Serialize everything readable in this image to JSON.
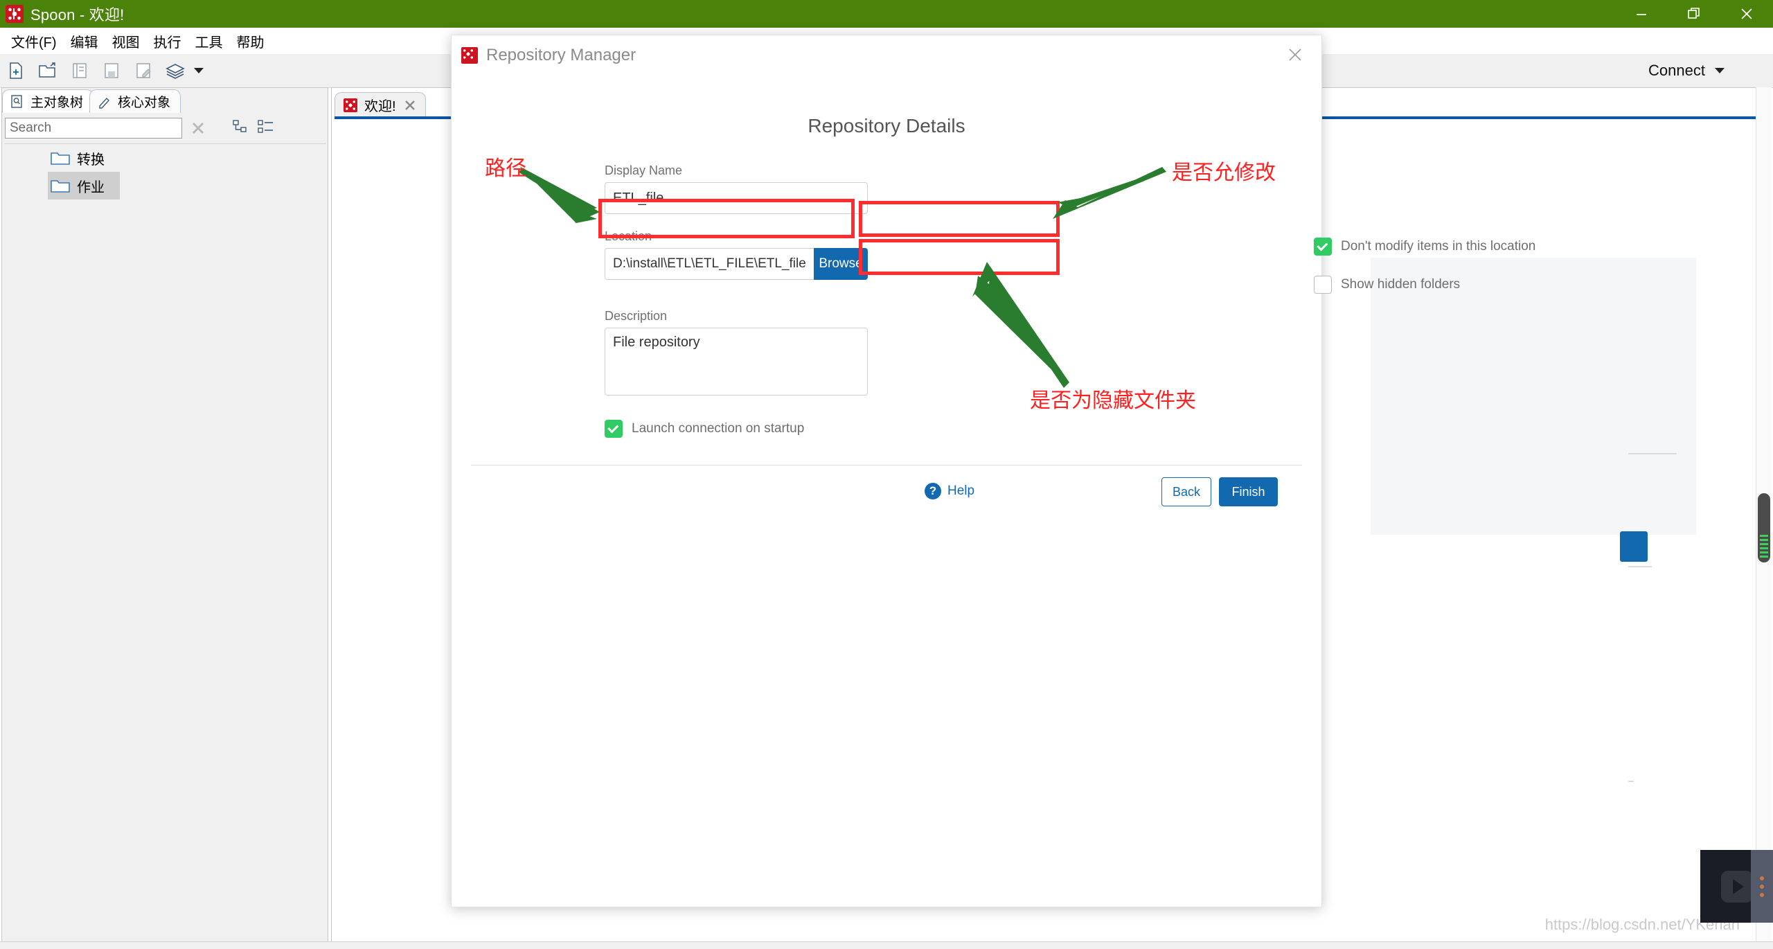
{
  "window": {
    "title": "Spoon - 欢迎!",
    "icon": "spoon-logo-icon",
    "minimize": "minimize-icon",
    "maximize": "maximize-icon",
    "close": "close-icon"
  },
  "menubar": {
    "items": [
      {
        "label": "文件(F)"
      },
      {
        "label": "编辑"
      },
      {
        "label": "视图"
      },
      {
        "label": "执行"
      },
      {
        "label": "工具"
      },
      {
        "label": "帮助"
      }
    ]
  },
  "toolbar": {
    "buttons": [
      {
        "name": "new-file-icon"
      },
      {
        "name": "open-file-icon"
      },
      {
        "name": "explorer-icon"
      },
      {
        "name": "save-icon"
      },
      {
        "name": "save-as-icon"
      },
      {
        "name": "layers-icon"
      }
    ],
    "connect_label": "Connect"
  },
  "sidebar": {
    "tabs": [
      {
        "label": "主对象树",
        "icon": "document-search-icon",
        "active": true
      },
      {
        "label": "核心对象",
        "icon": "pencil-icon",
        "active": false
      }
    ],
    "search": {
      "value": "Search",
      "placeholder": "Search"
    },
    "clear_icon": "clear-x-icon",
    "tree_view_icons": [
      "tree-hierarchy-icon",
      "tree-list-icon"
    ],
    "tree_nodes": [
      {
        "label": "转换",
        "selected": false
      },
      {
        "label": "作业",
        "selected": true
      }
    ]
  },
  "main": {
    "tabs": [
      {
        "label": "欢迎!",
        "close_icon": "tab-close-icon"
      }
    ]
  },
  "dialog": {
    "title": "Repository Manager",
    "close_icon": "dialog-close-icon",
    "heading": "Repository Details",
    "fields": {
      "display_name": {
        "label": "Display Name",
        "value": "ETL_file",
        "placeholder": ""
      },
      "location": {
        "label": "Location",
        "value": "D:\\install\\ETL\\ETL_FILE\\ETL_file",
        "placeholder": ""
      },
      "browse_label": "Browse",
      "description": {
        "label": "Description",
        "value": "File repository",
        "placeholder": ""
      }
    },
    "checkboxes": [
      {
        "name": "dont-modify-items",
        "label": "Don't modify items in this location",
        "checked": true
      },
      {
        "name": "show-hidden-folders",
        "label": "Show hidden folders",
        "checked": false
      },
      {
        "name": "launch-connection-on-startup",
        "label": "Launch connection on startup",
        "checked": true
      }
    ],
    "help": {
      "label": "Help",
      "icon": "help-icon"
    },
    "buttons": {
      "back": "Back",
      "finish": "Finish"
    }
  },
  "annotations": [
    {
      "name": "annotation-path",
      "text": "路径"
    },
    {
      "name": "annotation-allow-modify",
      "text": "是否允修改"
    },
    {
      "name": "annotation-hidden-folder",
      "text": "是否为隐藏文件夹"
    }
  ],
  "watermark": {
    "text": "https://blog.csdn.net/YKenan"
  },
  "colors": {
    "titlebar": "#4b8209",
    "accent_blue": "#1269b0",
    "annotation_red": "#ff2020",
    "annotation_green": "#2a7d2e",
    "checkbox_green": "#2ecc62"
  }
}
